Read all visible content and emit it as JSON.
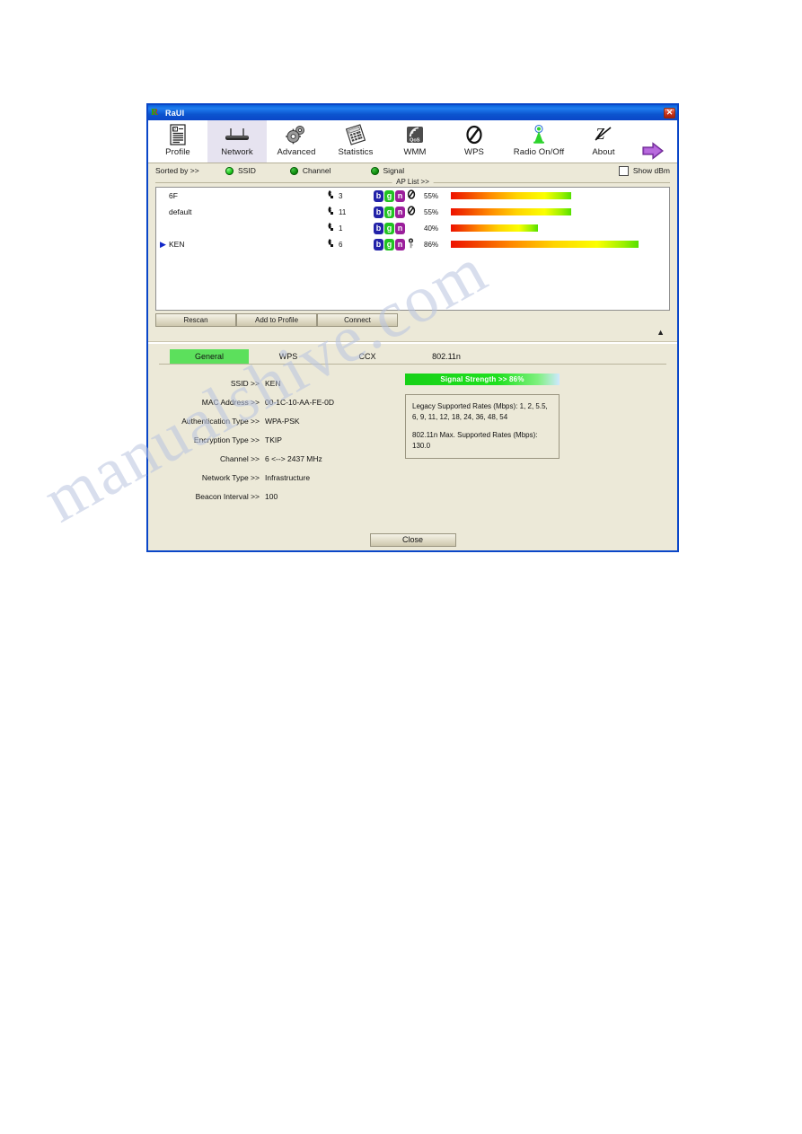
{
  "window": {
    "title": "RaUI",
    "close_glyph": "✕",
    "logo_letter": "R"
  },
  "toolbar": {
    "items": [
      {
        "label": "Profile",
        "icon": "profile-icon"
      },
      {
        "label": "Network",
        "icon": "router-icon"
      },
      {
        "label": "Advanced",
        "icon": "gears-icon"
      },
      {
        "label": "Statistics",
        "icon": "statistics-icon"
      },
      {
        "label": "WMM",
        "icon": "qos-icon"
      },
      {
        "label": "WPS",
        "icon": "wps-icon"
      },
      {
        "label": "Radio On/Off",
        "icon": "antenna-icon"
      },
      {
        "label": "About",
        "icon": "about-icon"
      }
    ],
    "next_arrow_icon": "arrow-right-icon",
    "selected_index": 1
  },
  "sortbar": {
    "sorted_by_label": "Sorted by >>",
    "options": [
      "SSID",
      "Channel",
      "Signal"
    ],
    "selected_option": "SSID",
    "show_dbm_label": "Show dBm",
    "show_dbm_checked": false,
    "ap_list_caption": "AP List >>"
  },
  "ap_list": {
    "rows": [
      {
        "ssid": "6F",
        "channel": "3",
        "badges": [
          "b",
          "g",
          "n"
        ],
        "wps": true,
        "secured": false,
        "signal": "55%",
        "signal_pct": 55,
        "selected": false
      },
      {
        "ssid": "default",
        "channel": "11",
        "badges": [
          "b",
          "g",
          "n"
        ],
        "wps": true,
        "secured": false,
        "signal": "55%",
        "signal_pct": 55,
        "selected": false
      },
      {
        "ssid": "",
        "channel": "1",
        "badges": [
          "b",
          "g",
          "n"
        ],
        "wps": false,
        "secured": false,
        "signal": "40%",
        "signal_pct": 40,
        "selected": false
      },
      {
        "ssid": "KEN",
        "channel": "6",
        "badges": [
          "b",
          "g",
          "n"
        ],
        "wps": false,
        "secured": true,
        "signal": "86%",
        "signal_pct": 86,
        "selected": true
      }
    ],
    "selection_marker": "▶",
    "wps_glyph": "↯",
    "key_glyph": "⚷",
    "channel_glyph": "✇"
  },
  "actions": {
    "rescan": "Rescan",
    "add_to_profile": "Add to Profile",
    "connect": "Connect",
    "collapse_glyph": "▲"
  },
  "detail_tabs": {
    "items": [
      "General",
      "WPS",
      "CCX",
      "802.11n"
    ],
    "active": "General"
  },
  "general": {
    "fields": [
      {
        "label": "SSID >>",
        "value": "KEN"
      },
      {
        "label": "MAC Address >>",
        "value": "00-1C-10-AA-FE-0D"
      },
      {
        "label": "Authentication Type >>",
        "value": "WPA-PSK"
      },
      {
        "label": "Encryption Type >>",
        "value": "TKIP"
      },
      {
        "label": "Channel >>",
        "value": "6 <--> 2437 MHz"
      },
      {
        "label": "Network Type >>",
        "value": "Infrastructure"
      },
      {
        "label": "Beacon Interval >>",
        "value": "100"
      }
    ],
    "signal_strength_label": "Signal Strength >> 86%",
    "rates": {
      "legacy_line1": "Legacy Supported Rates (Mbps): 1, 2, 5.5,",
      "legacy_line2": "6, 9, 11, 12, 18, 24, 36, 48, 54",
      "n_line1": "802.11n Max. Supported Rates (Mbps):",
      "n_line2": "130.0"
    }
  },
  "footer": {
    "close": "Close"
  },
  "watermark": {
    "text": "manualshive.com"
  },
  "colors": {
    "titlebar": "#0a46c8",
    "window_bg": "#ece9d8",
    "tab_active": "#5ce05c",
    "badge_b": "#2222a8",
    "badge_g": "#22c322",
    "badge_n": "#9b1f9b"
  }
}
